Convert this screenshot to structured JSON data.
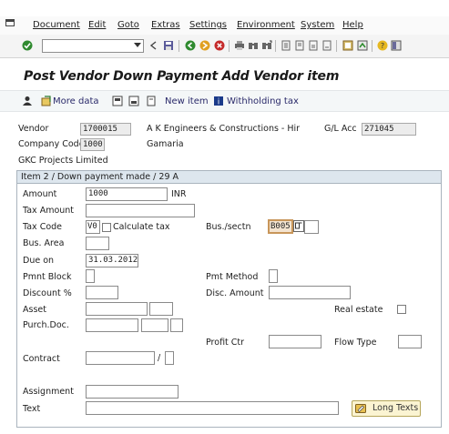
{
  "menu": {
    "items": [
      "Document",
      "Edit",
      "Goto",
      "Extras",
      "Settings",
      "Environment",
      "System",
      "Help"
    ]
  },
  "toolbar": {
    "command_field_value": "",
    "icons": [
      "enter-icon",
      "save-icon",
      "back-icon",
      "exit-icon",
      "cancel-icon",
      "print-icon",
      "find-icon",
      "find-next-icon",
      "first-page-icon",
      "previous-page-icon",
      "next-page-icon",
      "last-page-icon",
      "create-session-icon",
      "shortcut-icon",
      "help-icon",
      "layout-icon"
    ]
  },
  "title": "Post Vendor Down Payment Add Vendor item",
  "app_toolbar": {
    "more_data": "More data",
    "new_item": "New item",
    "withholding_tax": "Withholding tax"
  },
  "header": {
    "vendor_label": "Vendor",
    "vendor_value": "1700015",
    "vendor_name": "A K Engineers & Constructions - Hir",
    "gl_acc_label": "G/L Acc",
    "gl_acc_value": "271045",
    "company_code_label": "Company Code",
    "company_code_value": "1000",
    "company_name": "Gamaria",
    "company_city": "GKC Projects Limited"
  },
  "item": {
    "header": "Item 2 / Down payment made / 29 A",
    "amount_label": "Amount",
    "amount_value": "1000",
    "currency": "INR",
    "tax_amount_label": "Tax Amount",
    "tax_amount_value": "",
    "tax_code_label": "Tax Code",
    "tax_code_value": "V0",
    "calculate_tax_label": "Calculate tax",
    "bus_sectn_label": "Bus./sectn",
    "bus_sectn_value": "B005",
    "bus_area_label": "Bus. Area",
    "due_on_label": "Due on",
    "due_on_value": "31.03.2012",
    "pmnt_block_label": "Pmnt Block",
    "pmt_method_label": "Pmt Method",
    "discount_label": "Discount %",
    "disc_amount_label": "Disc. Amount",
    "asset_label": "Asset",
    "real_estate_label": "Real estate",
    "purch_doc_label": "Purch.Doc.",
    "profit_ctr_label": "Profit Ctr",
    "flow_type_label": "Flow Type",
    "contract_label": "Contract",
    "contract_sep": "/",
    "assignment_label": "Assignment",
    "text_label": "Text",
    "long_texts_button": "Long Texts"
  },
  "colors": {
    "title_text": "#1a1a1a",
    "focus_field_bg": "#f3e3cf",
    "focus_field_border": "#c8965a",
    "group_header_bg": "#dde6ee",
    "long_texts_bg": "#fbf4d2"
  }
}
